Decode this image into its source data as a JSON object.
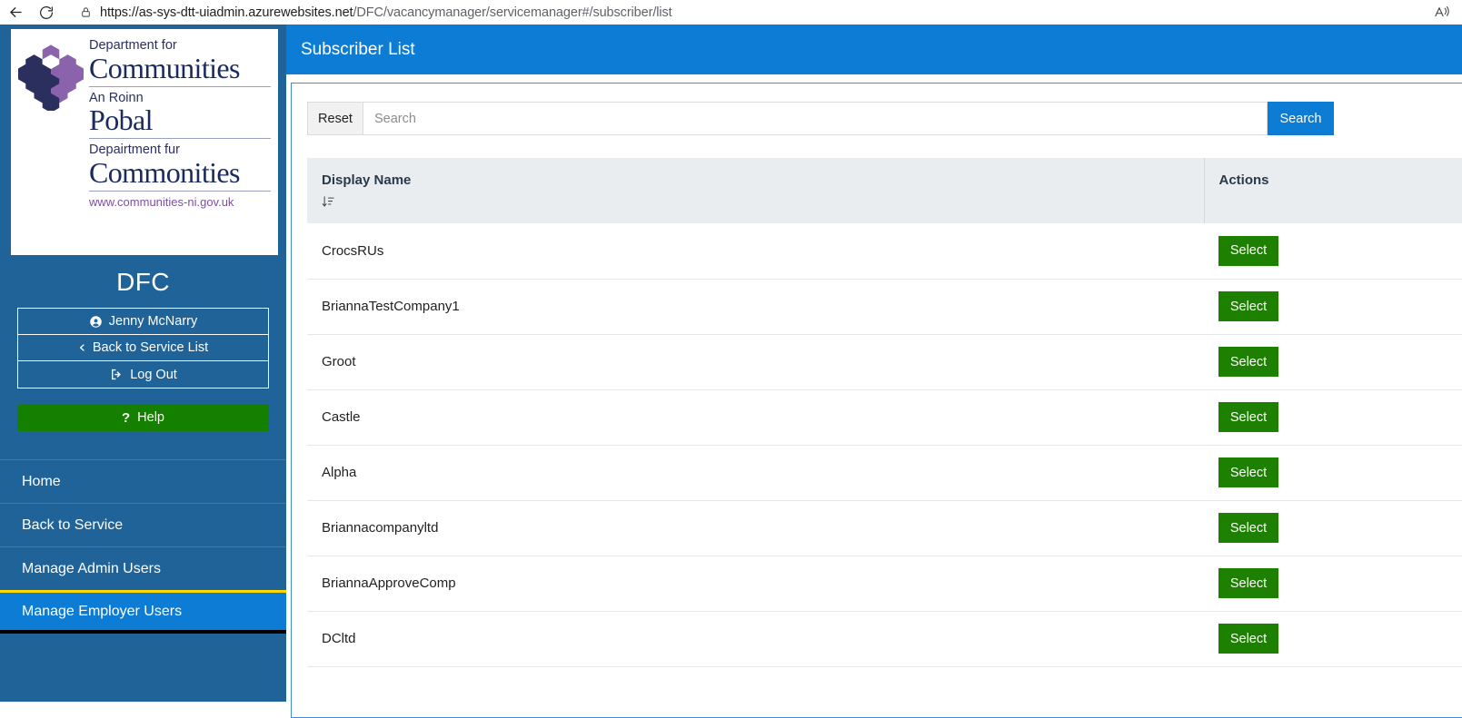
{
  "browser": {
    "back_icon": "back-arrow-icon",
    "reload_icon": "reload-icon",
    "lock_icon": "lock-icon",
    "url_domain": "https://as-sys-dtt-uiadmin.azurewebsites.net",
    "url_path": "/DFC/vacancymanager/servicemanager#/subscriber/list",
    "read_aloud_icon": "read-aloud-icon"
  },
  "sidebar": {
    "logo": {
      "line1_small": "Department for",
      "line1_big": "Communities",
      "line2_small": "An Roinn",
      "line2_big": "Pobal",
      "line3_small": "Depairtment fur",
      "line3_big": "Commonities",
      "url": "www.communities-ni.gov.uk"
    },
    "brand": "DFC",
    "account_buttons": [
      {
        "label": "Jenny McNarry",
        "icon": "user-circle-icon"
      },
      {
        "label": "Back to Service List",
        "icon": "chevron-left-icon"
      },
      {
        "label": "Log Out",
        "icon": "logout-icon"
      }
    ],
    "help": {
      "label": "Help",
      "icon": "question-mark-icon"
    },
    "nav_items": [
      {
        "label": "Home",
        "active": false
      },
      {
        "label": "Back to Service",
        "active": false
      },
      {
        "label": "Manage Admin Users",
        "active": false
      },
      {
        "label": "Manage Employer Users",
        "active": true
      }
    ]
  },
  "header": {
    "title": "Subscriber List"
  },
  "search": {
    "reset_label": "Reset",
    "placeholder": "Search",
    "value": "",
    "search_label": "Search"
  },
  "table": {
    "columns": [
      {
        "label": "Display Name",
        "sort_icon": "sort-ascending-icon"
      },
      {
        "label": "Actions"
      }
    ],
    "rows": [
      {
        "display_name": "CrocsRUs",
        "action_label": "Select"
      },
      {
        "display_name": "BriannaTestCompany1",
        "action_label": "Select"
      },
      {
        "display_name": "Groot",
        "action_label": "Select"
      },
      {
        "display_name": "Castle",
        "action_label": "Select"
      },
      {
        "display_name": "Alpha",
        "action_label": "Select"
      },
      {
        "display_name": "Briannacompanyltd",
        "action_label": "Select"
      },
      {
        "display_name": "BriannaApproveComp",
        "action_label": "Select"
      },
      {
        "display_name": "DCltd",
        "action_label": "Select"
      }
    ]
  },
  "colors": {
    "sidebar_blue": "#1f6399",
    "accent_blue": "#0c7cd5",
    "active_top": "#ffd900",
    "help_green": "#158000",
    "select_green": "#1e8000",
    "header_gray": "#e9edf0"
  }
}
